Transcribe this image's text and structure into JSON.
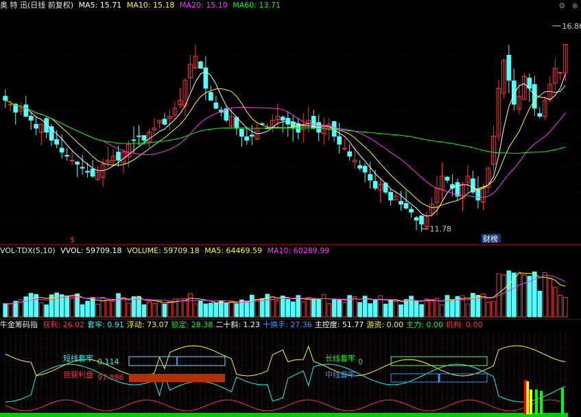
{
  "main_header": {
    "title": "奥 特 迅(日线 前复权)",
    "ma5": "MA5: 15.71",
    "ma10": "MA10: 15.18",
    "ma20": "MA20: 15.10",
    "ma60": "MA60: 13.71"
  },
  "vol_header": {
    "name": "VOL-TDX(5,10)",
    "vvol": "VVOL: 59709.18",
    "volume": "VOLUME: 59709.18",
    "ma5": "MA5: 64469.59",
    "ma10": "MA10: 60289.99"
  },
  "ind_header": {
    "name": "牛金筹码指",
    "items": [
      {
        "label": "获利: 26.02",
        "color": "#ff3333"
      },
      {
        "label": "套牢: 0.91",
        "color": "#00ffff"
      },
      {
        "label": "浮动: 73.07",
        "color": "#ffff00"
      },
      {
        "label": "锁定: 28.38",
        "color": "#00ff00"
      },
      {
        "label": "二十斜: 1.23",
        "color": "#ffffff"
      },
      {
        "label": "十换手: 27.36",
        "color": "#3399ff"
      },
      {
        "label": "主控度: 51.77",
        "color": "#ffffff"
      },
      {
        "label": "游资: 0.00",
        "color": "#ffff00"
      },
      {
        "label": "主力: 0.00",
        "color": "#00ff00"
      },
      {
        "label": "机构: 0.00",
        "color": "#ff3333"
      }
    ]
  },
  "annotations": {
    "high": "16.86",
    "low": "11.78",
    "caibang": "财榜",
    "dollar": "$",
    "short_trap": "短线套牢",
    "short_trap_val": "0.114",
    "profit": "目获利盘",
    "profit_val": "97.886",
    "long_trap": "长线套牢",
    "long_trap_val": "0",
    "mid_trap": "中线套牢"
  },
  "colors": {
    "up": "#ff3232",
    "down": "#54fcfc",
    "ma5": "#ffffff",
    "ma10": "#ffff00",
    "ma20": "#ff33ff",
    "ma60": "#00ff00"
  },
  "chart_data": {
    "type": "candlestick",
    "title": "奥 特 迅(日线 前复权)",
    "ylim": [
      11.5,
      17.2
    ],
    "price_high": 16.86,
    "price_low": 11.78,
    "closes": [
      15.0,
      14.9,
      14.7,
      14.8,
      14.6,
      14.5,
      14.3,
      14.4,
      14.2,
      14.0,
      13.9,
      13.7,
      13.6,
      13.5,
      13.4,
      13.3,
      13.2,
      13.1,
      13.2,
      13.4,
      13.5,
      13.6,
      13.5,
      13.7,
      13.9,
      14.0,
      14.1,
      14.0,
      14.2,
      14.3,
      14.5,
      14.4,
      14.6,
      14.8,
      15.0,
      15.5,
      15.9,
      16.1,
      15.8,
      15.3,
      15.0,
      14.8,
      14.7,
      14.5,
      14.6,
      14.3,
      14.1,
      14.0,
      14.1,
      14.3,
      14.4,
      14.3,
      14.5,
      14.6,
      14.5,
      14.4,
      14.3,
      14.2,
      14.4,
      14.5,
      14.3,
      14.2,
      14.3,
      14.4,
      14.1,
      13.9,
      13.8,
      13.6,
      13.5,
      13.3,
      13.2,
      13.0,
      12.8,
      12.9,
      12.7,
      12.5,
      12.6,
      12.4,
      12.3,
      12.2,
      12.0,
      11.9,
      12.1,
      12.4,
      12.8,
      13.1,
      13.0,
      12.8,
      12.6,
      12.9,
      13.1,
      12.7,
      12.5,
      12.8,
      13.3,
      14.1,
      15.3,
      16.0,
      15.5,
      14.9,
      15.1,
      15.6,
      15.3,
      14.8,
      14.6,
      15.0,
      15.4,
      15.8,
      15.7,
      16.4
    ],
    "volume_ma5": 64469.59,
    "volume_ma10": 60289.99,
    "indicator": {
      "profit": 26.02,
      "trapped": 0.91,
      "float": 73.07,
      "locked": 28.38,
      "slope20": 1.23,
      "turnover10": 27.36,
      "control": 51.77,
      "hot_money": 0.0,
      "main_force": 0.0,
      "institution": 0.0
    }
  }
}
